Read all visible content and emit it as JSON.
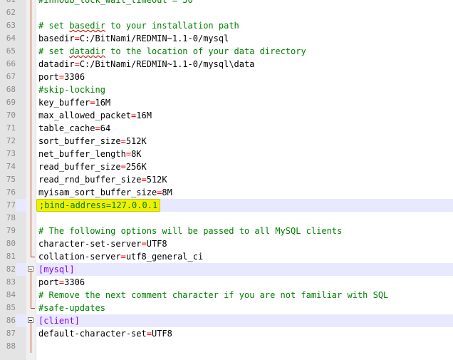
{
  "editor": {
    "lines": [
      {
        "num": "61",
        "segments": [
          {
            "text": "#innodb_lock_wait_timeout = 50",
            "cls": "c-comment"
          }
        ]
      },
      {
        "num": "62",
        "segments": []
      },
      {
        "num": "63",
        "segments": [
          {
            "text": "# set ",
            "cls": "c-comment"
          },
          {
            "text": "basedir",
            "cls": "c-comment squiggle"
          },
          {
            "text": " to your installation path",
            "cls": "c-comment"
          }
        ]
      },
      {
        "num": "64",
        "segments": [
          {
            "text": "basedir",
            "cls": "c-key"
          },
          {
            "text": "=",
            "cls": "c-op"
          },
          {
            "text": "C:/BitNami/REDMIN~1.1-0/mysql",
            "cls": "c-val"
          }
        ]
      },
      {
        "num": "65",
        "segments": [
          {
            "text": "# set ",
            "cls": "c-comment"
          },
          {
            "text": "datadir",
            "cls": "c-comment squiggle"
          },
          {
            "text": " to the location of your data directory",
            "cls": "c-comment"
          }
        ]
      },
      {
        "num": "66",
        "segments": [
          {
            "text": "datadir",
            "cls": "c-key"
          },
          {
            "text": "=",
            "cls": "c-op"
          },
          {
            "text": "C:/BitNami/REDMIN~1.1-0/mysql\\data",
            "cls": "c-val"
          }
        ]
      },
      {
        "num": "67",
        "segments": [
          {
            "text": "port",
            "cls": "c-key"
          },
          {
            "text": "=",
            "cls": "c-op"
          },
          {
            "text": "3306",
            "cls": "c-val"
          }
        ]
      },
      {
        "num": "68",
        "segments": [
          {
            "text": "#skip-locking",
            "cls": "c-comment"
          }
        ]
      },
      {
        "num": "69",
        "segments": [
          {
            "text": "key_buffer",
            "cls": "c-key"
          },
          {
            "text": "=",
            "cls": "c-op"
          },
          {
            "text": "16M",
            "cls": "c-val"
          }
        ]
      },
      {
        "num": "70",
        "segments": [
          {
            "text": "max_allowed_packet",
            "cls": "c-key"
          },
          {
            "text": "=",
            "cls": "c-op"
          },
          {
            "text": "16M",
            "cls": "c-val"
          }
        ]
      },
      {
        "num": "71",
        "segments": [
          {
            "text": "table_cache",
            "cls": "c-key"
          },
          {
            "text": "=",
            "cls": "c-op"
          },
          {
            "text": "64",
            "cls": "c-val"
          }
        ]
      },
      {
        "num": "72",
        "segments": [
          {
            "text": "sort_buffer_size",
            "cls": "c-key"
          },
          {
            "text": "=",
            "cls": "c-op"
          },
          {
            "text": "512K",
            "cls": "c-val"
          }
        ]
      },
      {
        "num": "73",
        "segments": [
          {
            "text": "net_buffer_length",
            "cls": "c-key"
          },
          {
            "text": "=",
            "cls": "c-op"
          },
          {
            "text": "8K",
            "cls": "c-val"
          }
        ]
      },
      {
        "num": "74",
        "segments": [
          {
            "text": "read_buffer_size",
            "cls": "c-key"
          },
          {
            "text": "=",
            "cls": "c-op"
          },
          {
            "text": "256K",
            "cls": "c-val"
          }
        ]
      },
      {
        "num": "75",
        "segments": [
          {
            "text": "read_rnd_buffer_size",
            "cls": "c-key"
          },
          {
            "text": "=",
            "cls": "c-op"
          },
          {
            "text": "512K",
            "cls": "c-val"
          }
        ]
      },
      {
        "num": "76",
        "segments": [
          {
            "text": "myisam_sort_buffer_size",
            "cls": "c-key"
          },
          {
            "text": "=",
            "cls": "c-op"
          },
          {
            "text": "8M",
            "cls": "c-val"
          }
        ]
      },
      {
        "num": "77",
        "current": true,
        "highlight": true,
        "segments": [
          {
            "text": ";bind-address=127.0.0.1",
            "cls": "c-comment"
          }
        ]
      },
      {
        "num": "78",
        "segments": []
      },
      {
        "num": "79",
        "segments": [
          {
            "text": "# The following options will be passed to all MySQL clients",
            "cls": "c-comment"
          }
        ]
      },
      {
        "num": "80",
        "segments": [
          {
            "text": "character-set-server",
            "cls": "c-key"
          },
          {
            "text": "=",
            "cls": "c-op"
          },
          {
            "text": "UTF8",
            "cls": "c-val"
          }
        ]
      },
      {
        "num": "81",
        "fold": "end",
        "segments": [
          {
            "text": "collation-server",
            "cls": "c-key"
          },
          {
            "text": "=",
            "cls": "c-op"
          },
          {
            "text": "utf8_general_ci",
            "cls": "c-val"
          }
        ]
      },
      {
        "num": "82",
        "fold": "start",
        "section": true,
        "segments": [
          {
            "text": "[mysql]",
            "cls": "c-section"
          }
        ]
      },
      {
        "num": "83",
        "fold": "mid",
        "segments": [
          {
            "text": "port",
            "cls": "c-key"
          },
          {
            "text": "=",
            "cls": "c-op"
          },
          {
            "text": "3306",
            "cls": "c-val"
          }
        ]
      },
      {
        "num": "84",
        "fold": "mid",
        "segments": [
          {
            "text": "# Remove the next comment character if you are not familiar with SQL",
            "cls": "c-comment"
          }
        ]
      },
      {
        "num": "85",
        "fold": "end",
        "segments": [
          {
            "text": "#safe-updates",
            "cls": "c-comment"
          }
        ]
      },
      {
        "num": "86",
        "fold": "start",
        "section": true,
        "segments": [
          {
            "text": "[client]",
            "cls": "c-section"
          }
        ]
      },
      {
        "num": "87",
        "fold": "mid",
        "segments": [
          {
            "text": "default-character-set",
            "cls": "c-key"
          },
          {
            "text": "=",
            "cls": "c-op"
          },
          {
            "text": "UTF8",
            "cls": "c-val"
          }
        ]
      },
      {
        "num": "88",
        "fold": "mid",
        "segments": []
      }
    ],
    "fold_line_color": "#c23c1f",
    "gutter_color": "#e4e4e4",
    "current_line_color": "#e8e8ff",
    "highlight_color": "#f0f000"
  }
}
